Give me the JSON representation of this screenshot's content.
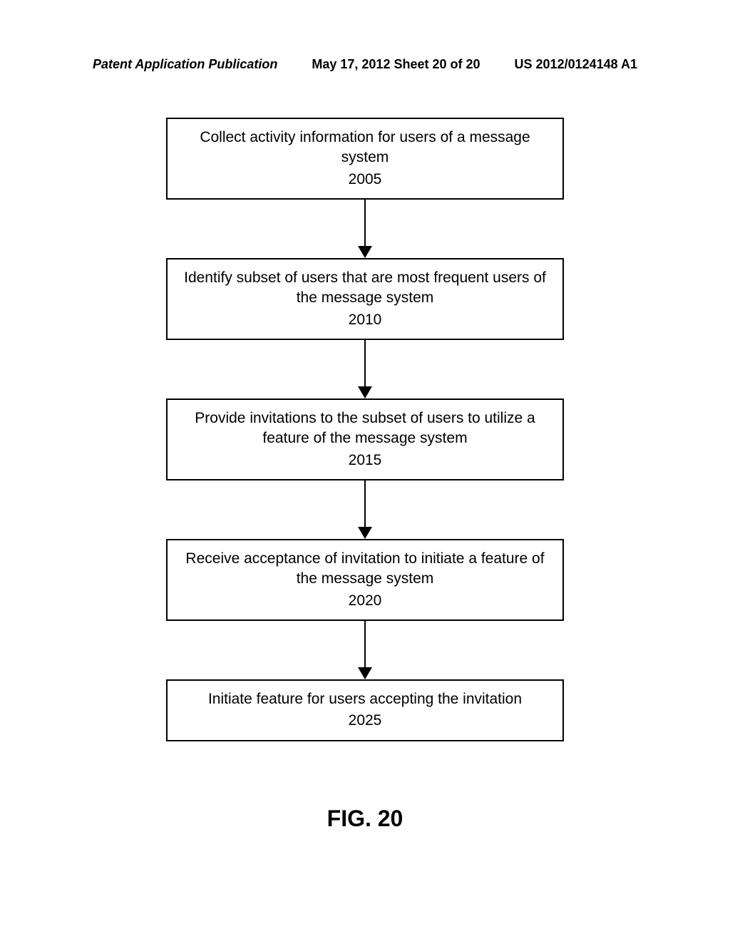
{
  "header": {
    "left": "Patent Application Publication",
    "center": "May 17, 2012  Sheet 20 of 20",
    "right": "US 2012/0124148 A1"
  },
  "flowchart": {
    "boxes": [
      {
        "text": "Collect activity information for users of a message system",
        "number": "2005"
      },
      {
        "text": "Identify subset of users that are most frequent users of the message system",
        "number": "2010"
      },
      {
        "text": "Provide invitations to the subset of users to utilize a feature of the message system",
        "number": "2015"
      },
      {
        "text": "Receive acceptance of invitation to initiate a feature of the message system",
        "number": "2020"
      },
      {
        "text": "Initiate feature for users accepting the invitation",
        "number": "2025"
      }
    ]
  },
  "figure_caption": "FIG. 20"
}
